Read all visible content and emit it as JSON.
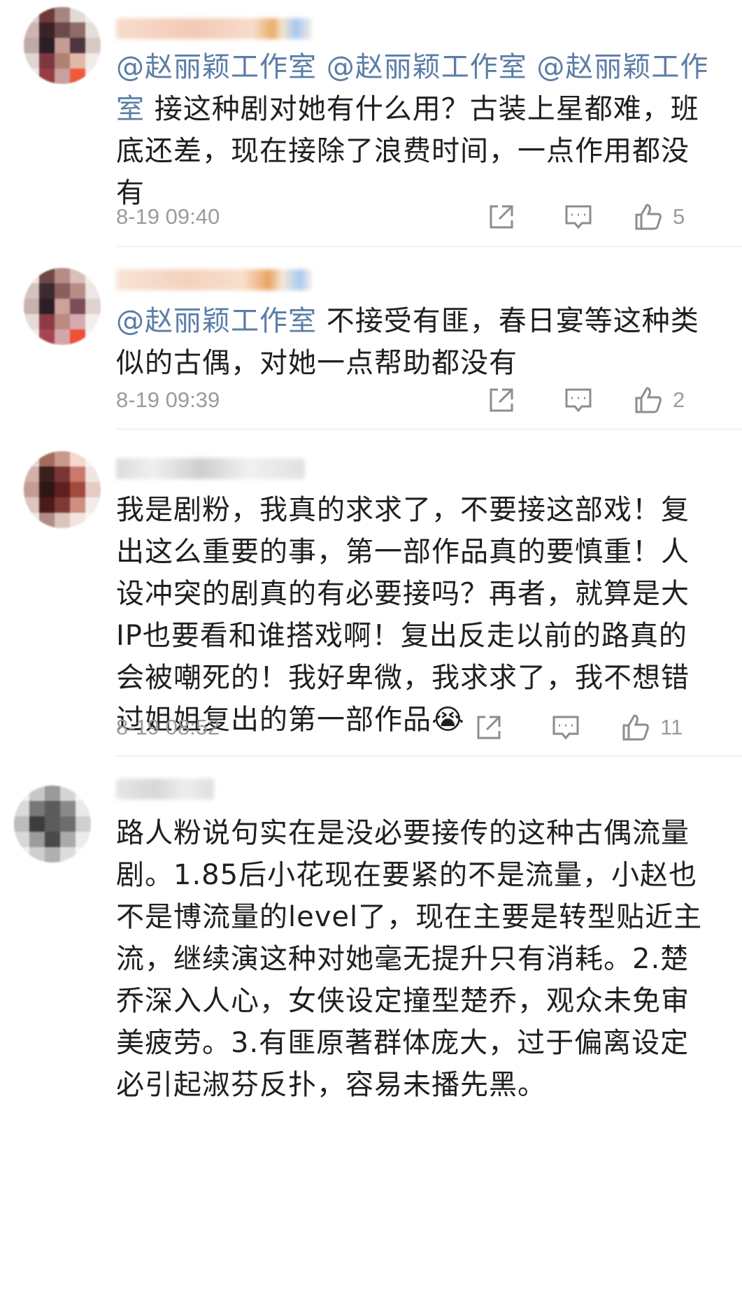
{
  "comments": [
    {
      "mention": "@赵丽颖工作室 @赵丽颖工作室 @赵丽颖工作室",
      "text": " 接这种剧对她有什么用？古装上星都难，班底还差，现在接除了浪费时间，一点作用都没有",
      "time": "8-19 09:40",
      "likes": "5"
    },
    {
      "mention": "@赵丽颖工作室",
      "text": " 不接受有匪，春日宴等这种类似的古偶，对她一点帮助都没有",
      "time": "8-19 09:39",
      "likes": "2"
    },
    {
      "mention": "",
      "text": "我是剧粉，我真的求求了，不要接这部戏！复出这么重要的事，第一部作品真的要慎重！人设冲突的剧真的有必要接吗？再者，就算是大IP也要看和谁搭戏啊！复出反走以前的路真的会被嘲死的！我好卑微，我求求了，我不想错过姐姐复出的第一部作品😭",
      "time": "8-19 08:52",
      "likes": "11"
    },
    {
      "mention": "",
      "text": "路人粉说句实在是没必要接传的这种古偶流量剧。1.85后小花现在要紧的不是流量，小赵也不是博流量的level了，现在主要是转型贴近主流，继续演这种对她毫无提升只有消耗。2.楚乔深入人心，女侠设定撞型楚乔，观众未免审美疲劳。3.有匪原著群体庞大，过于偏离设定必引起淑芬反扑，容易未播先黑。",
      "time": "",
      "likes": ""
    }
  ],
  "icons": [
    "repost-icon",
    "comment-icon",
    "like-icon"
  ],
  "colors": {
    "mention": "#5b7da7",
    "meta": "#9b9b9b",
    "text": "#1f1f1f"
  }
}
